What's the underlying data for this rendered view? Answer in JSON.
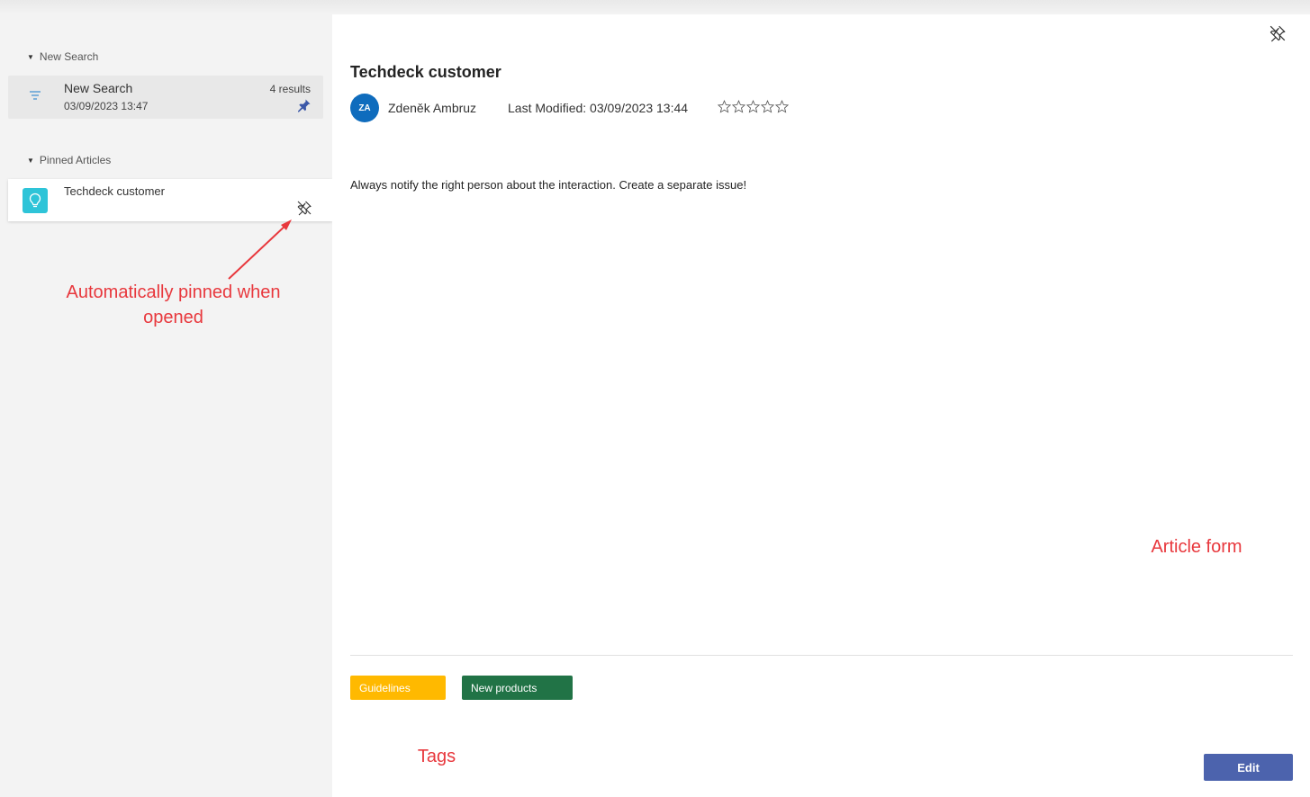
{
  "sidebar": {
    "new_search_header": "New Search",
    "search_item": {
      "title": "New Search",
      "date": "03/09/2023 13:47",
      "results": "4 results",
      "icon": "filter-icon",
      "pin_icon": "pin-filled-icon"
    },
    "pinned_header": "Pinned Articles",
    "pinned_item": {
      "title": "Techdeck customer",
      "icon": "lightbulb-icon",
      "unpin_icon": "unpin-icon"
    }
  },
  "annotations": {
    "pinned_note": "Automatically pinned when opened",
    "article_form": "Article form",
    "tags": "Tags"
  },
  "article": {
    "title": "Techdeck customer",
    "author_initials": "ZA",
    "author": "Zdeněk Ambruz",
    "last_modified": "Last Modified: 03/09/2023 13:44",
    "rating": 0,
    "rating_max": 5,
    "body": "Always notify the right person about the interaction. Create a separate issue!",
    "tags": [
      {
        "label": "Guidelines",
        "color": "#ffb900"
      },
      {
        "label": "New products",
        "color": "#217346"
      }
    ],
    "edit_label": "Edit"
  },
  "colors": {
    "annotation": "#e8383d",
    "avatar": "#0f6cbd",
    "edit_button": "#4c63ad",
    "bulb_tile": "#2ec4d8"
  }
}
